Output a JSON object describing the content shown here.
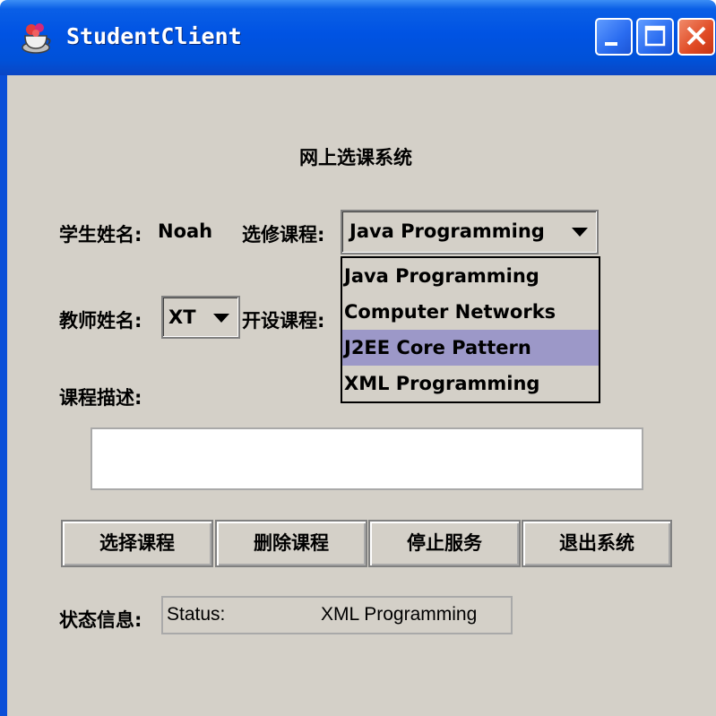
{
  "window": {
    "title": "StudentClient"
  },
  "form": {
    "heading": "网上选课系统",
    "student_label": "学生姓名:",
    "student_name": "Noah",
    "course_label": "选修课程:",
    "course_selected": "Java Programming",
    "teacher_label": "教师姓名:",
    "teacher_selected": "XT",
    "offered_label": "开设课程:",
    "description_label": "课程描述:"
  },
  "dropdown": {
    "items": [
      {
        "label": "Java Programming"
      },
      {
        "label": "Computer Networks"
      },
      {
        "label": "J2EE Core Pattern"
      },
      {
        "label": "XML Programming"
      }
    ],
    "highlighted_index": 2,
    "highlight_color": "#9c98c8"
  },
  "buttons": {
    "select_course": "选择课程",
    "delete_course": "删除课程",
    "stop_service": "停止服务",
    "exit_system": "退出系统"
  },
  "status": {
    "label": "状态信息:",
    "prefix": "Status:",
    "value": "XML Programming"
  },
  "icons": {
    "app": "java-cup-icon",
    "minimize": "minimize-icon",
    "maximize": "maximize-icon",
    "close": "close-icon",
    "dropdown_arrow": "chevron-down-icon"
  },
  "colors": {
    "titlebar": "#0053e3",
    "client_bg": "#d4d0c8",
    "close_button": "#e04a24"
  }
}
